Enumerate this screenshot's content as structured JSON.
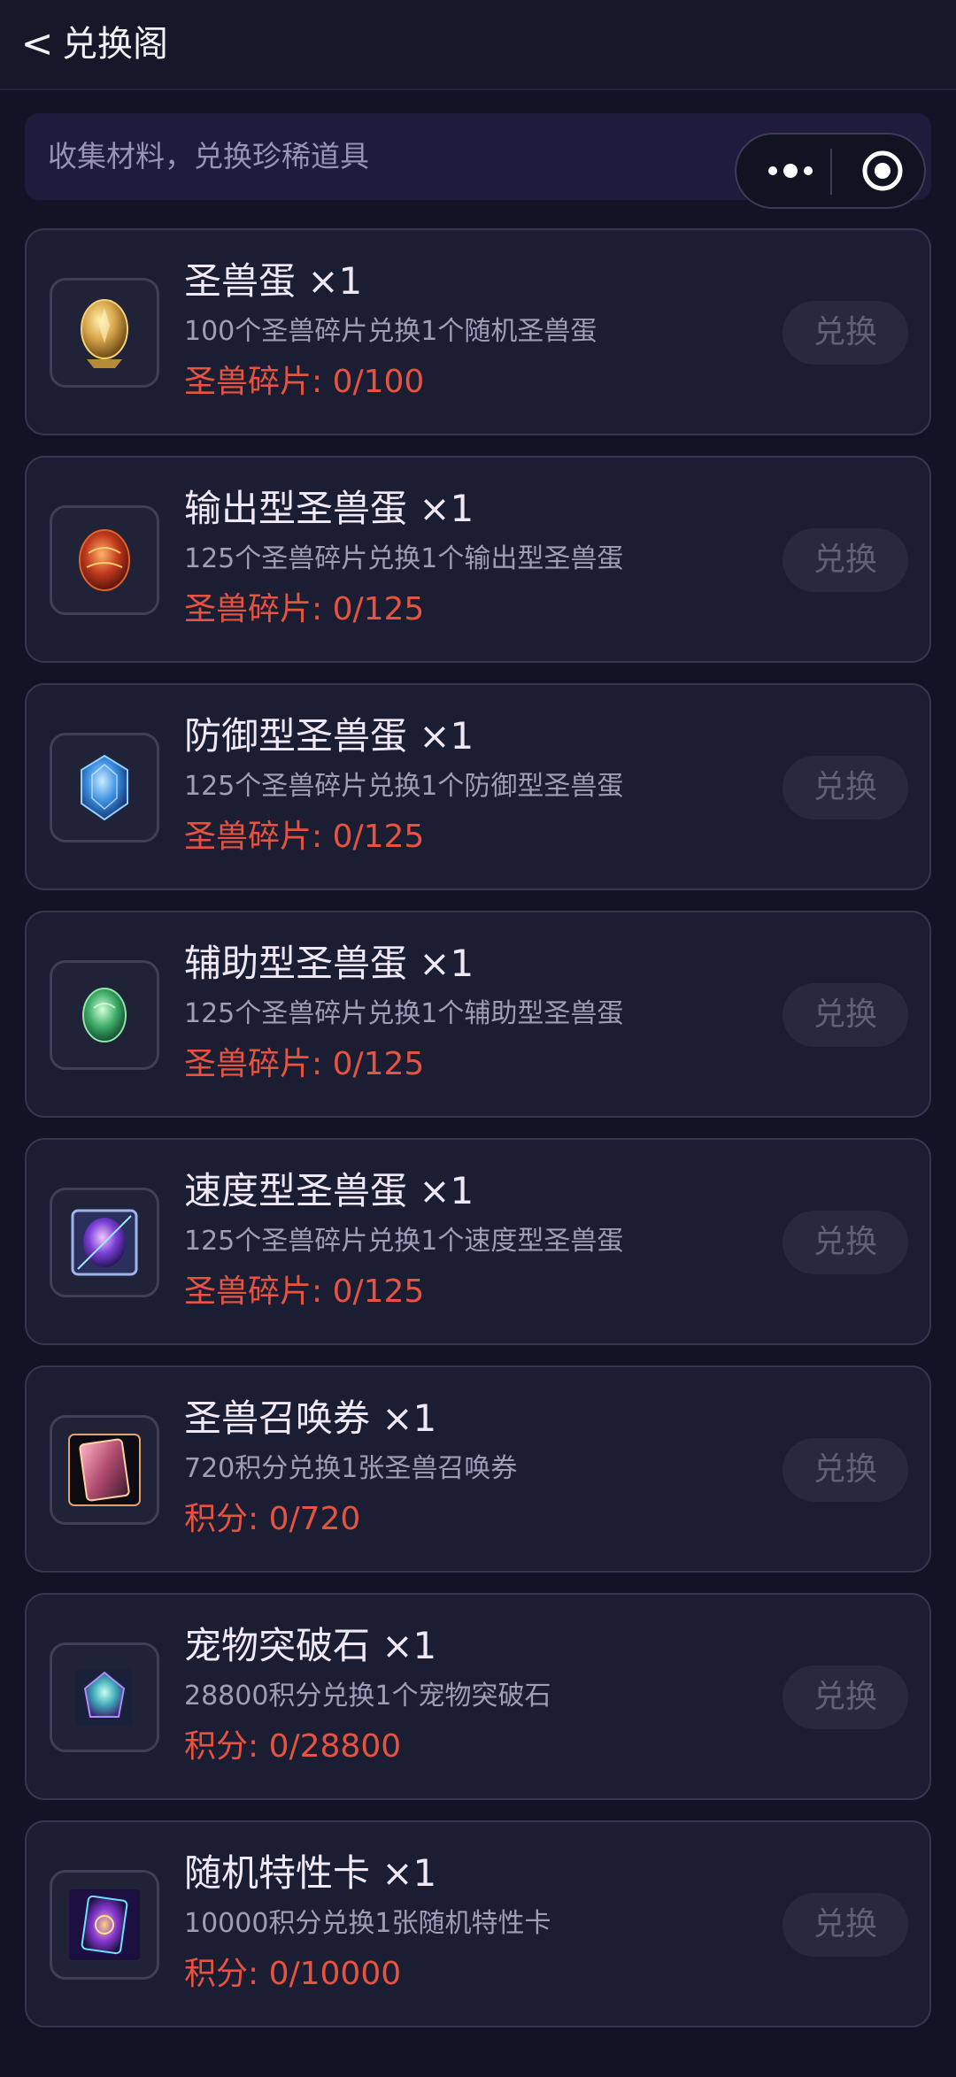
{
  "header": {
    "back_icon": "<",
    "title": "兑换阁"
  },
  "banner": {
    "text": "收集材料，兑换珍稀道具"
  },
  "capsule": {
    "more_icon": "more-dots-icon",
    "target_icon": "target-icon"
  },
  "items": [
    {
      "icon": "golden-egg-icon",
      "title": "圣兽蛋 ×1",
      "desc": "100个圣兽碎片兑换1个随机圣兽蛋",
      "progress": "圣兽碎片: 0/100",
      "progress_fraction": 0,
      "button": "兑换"
    },
    {
      "icon": "red-egg-icon",
      "title": "输出型圣兽蛋 ×1",
      "desc": "125个圣兽碎片兑换1个输出型圣兽蛋",
      "progress": "圣兽碎片: 0/125",
      "progress_fraction": 0,
      "button": "兑换"
    },
    {
      "icon": "blue-egg-icon",
      "title": "防御型圣兽蛋 ×1",
      "desc": "125个圣兽碎片兑换1个防御型圣兽蛋",
      "progress": "圣兽碎片: 0/125",
      "progress_fraction": 0,
      "button": "兑换"
    },
    {
      "icon": "green-egg-icon",
      "title": "辅助型圣兽蛋 ×1",
      "desc": "125个圣兽碎片兑换1个辅助型圣兽蛋",
      "progress": "圣兽碎片: 0/125",
      "progress_fraction": 0,
      "button": "兑换"
    },
    {
      "icon": "purple-egg-icon",
      "title": "速度型圣兽蛋 ×1",
      "desc": "125个圣兽碎片兑换1个速度型圣兽蛋",
      "progress": "圣兽碎片: 0/125",
      "progress_fraction": 0,
      "button": "兑换"
    },
    {
      "icon": "summon-ticket-icon",
      "title": "圣兽召唤券 ×1",
      "desc": "720积分兑换1张圣兽召唤券",
      "progress": "积分: 0/720",
      "progress_fraction": 0,
      "button": "兑换"
    },
    {
      "icon": "breakthrough-stone-icon",
      "title": "宠物突破石 ×1",
      "desc": "28800积分兑换1个宠物突破石",
      "progress": "积分: 0/28800",
      "progress_fraction": 0,
      "button": "兑换"
    },
    {
      "icon": "trait-card-icon",
      "title": "随机特性卡 ×1",
      "desc": "10000积分兑换1张随机特性卡",
      "progress": "积分: 0/10000",
      "progress_fraction": 0,
      "button": "兑换"
    }
  ],
  "colors": {
    "background": "#121426",
    "card": "#1b1e33",
    "progress_text": "#e8533f",
    "button_disabled": "#272a3d"
  }
}
